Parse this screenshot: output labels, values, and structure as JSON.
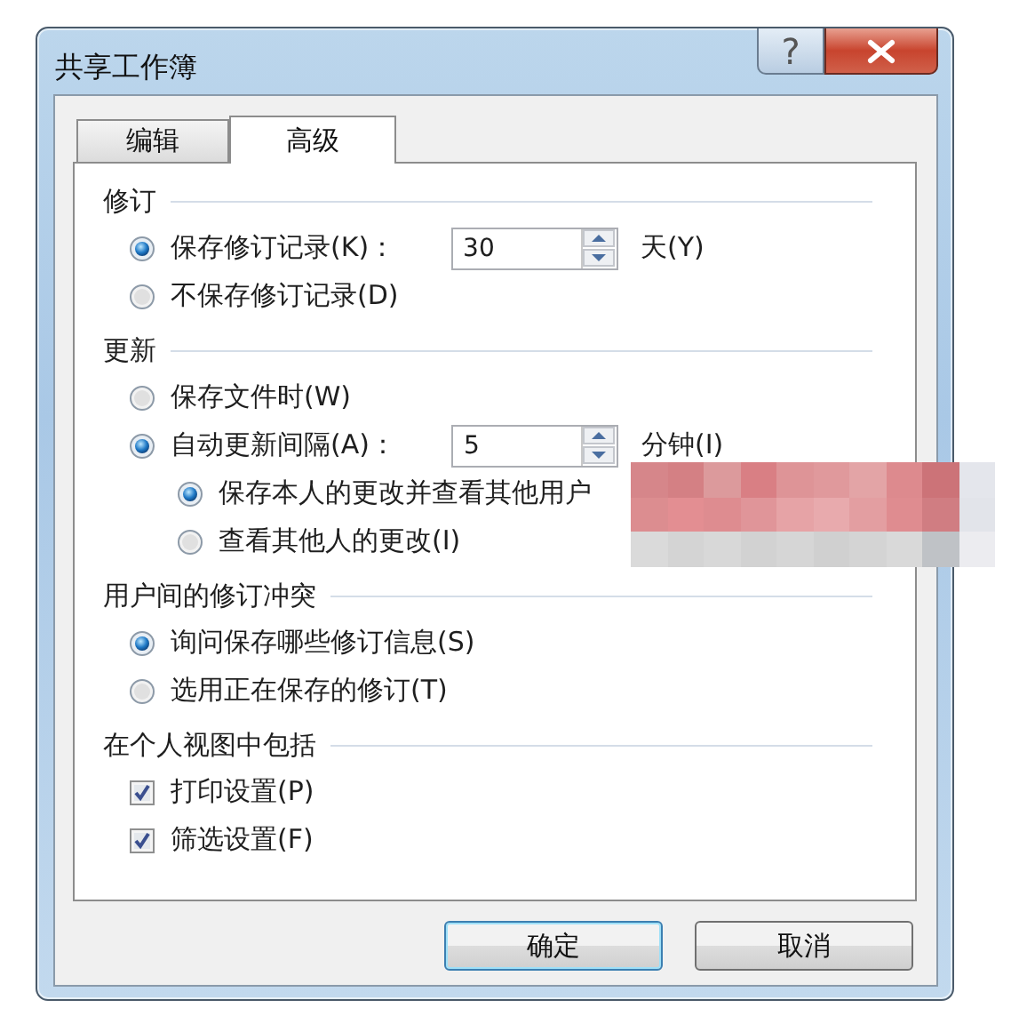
{
  "window": {
    "title": "共享工作簿",
    "help_label": "?"
  },
  "tabs": [
    {
      "label": "编辑",
      "selected": false
    },
    {
      "label": "高级",
      "selected": true
    }
  ],
  "sections": [
    {
      "title": "修订",
      "items": [
        {
          "kind": "radio",
          "label": "保存修订记录(K)：",
          "selected": true,
          "spin": {
            "value": "30",
            "unit": "天(Y)"
          }
        },
        {
          "kind": "radio",
          "label": "不保存修订记录(D)",
          "selected": false
        }
      ]
    },
    {
      "title": "更新",
      "items": [
        {
          "kind": "radio",
          "label": "保存文件时(W)",
          "selected": false
        },
        {
          "kind": "radio",
          "label": "自动更新间隔(A)：",
          "selected": true,
          "spin": {
            "value": "5",
            "unit": "分钟(I)"
          },
          "children": [
            {
              "kind": "radio",
              "label": "保存本人的更改并查看其他用户",
              "selected": true
            },
            {
              "kind": "radio",
              "label": "查看其他人的更改(I)",
              "selected": false
            }
          ]
        }
      ]
    },
    {
      "title": "用户间的修订冲突",
      "items": [
        {
          "kind": "radio",
          "label": "询问保存哪些修订信息(S)",
          "selected": true
        },
        {
          "kind": "radio",
          "label": "选用正在保存的修订(T)",
          "selected": false
        }
      ]
    },
    {
      "title": "在个人视图中包括",
      "items": [
        {
          "kind": "checkbox",
          "label": "打印设置(P)",
          "checked": true
        },
        {
          "kind": "checkbox",
          "label": "筛选设置(F)",
          "checked": true
        }
      ]
    }
  ],
  "buttons": [
    {
      "label": "确定",
      "default": true
    },
    {
      "label": "取消",
      "default": false
    }
  ],
  "redaction": {
    "kind": "mosaic"
  }
}
